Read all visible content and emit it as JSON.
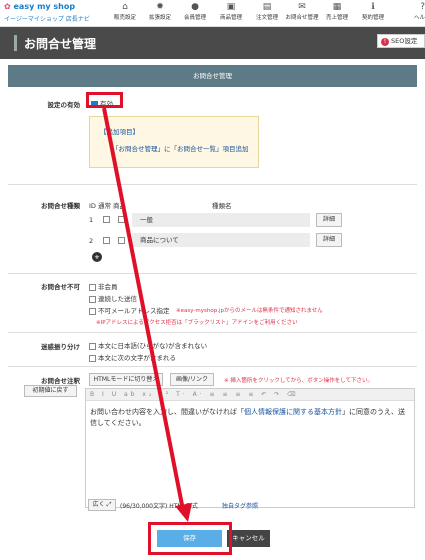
{
  "app": {
    "logo": "easy my shop",
    "logo_sub": "イージーマイショップ 店長ナビ"
  },
  "nav": [
    "販売設定",
    "拡張設定",
    "会員管理",
    "商品管理",
    "注文管理",
    "お問合せ管理",
    "売上管理",
    "契約管理",
    "ヘル"
  ],
  "nav_icons": [
    "home-icon",
    "gear-icon",
    "person-icon",
    "gift-icon",
    "cart-icon",
    "mail-icon",
    "calculator-icon",
    "info-icon",
    "help-icon"
  ],
  "page_title": "お問合せ管理",
  "seo_label": "SEO設定",
  "section_header": "お問合せ管理",
  "enabled": {
    "label": "設定の有効",
    "option": "有効",
    "checked": true
  },
  "notice": {
    "title": "【追加項目】",
    "body": "「お問合せ管理」に「お問合せ一覧」項目追加"
  },
  "types": {
    "label": "お問合せ種類",
    "cols": "ID 通常 商品",
    "col_name": "種類名",
    "rows": [
      {
        "id": "1",
        "name": "一般",
        "btn": "詳細"
      },
      {
        "id": "2",
        "name": "商品について",
        "btn": "詳細"
      }
    ]
  },
  "not_allowed": {
    "label": "お問合せ不可",
    "options": [
      "非会員",
      "連続した送信",
      "不可メールアドレス指定"
    ],
    "note1": "※easy-myshop.jpからのメールは無条件で通知されません",
    "note2": "※IPアドレスによるアクセス拒否は「ブラックリスト」アドインをご利用ください"
  },
  "spam": {
    "label": "迷惑振り分け",
    "options": [
      "本文に日本語(ひらがな)が含まれない",
      "本文に次の文字が含まれる"
    ]
  },
  "caution": {
    "label": "お問合せ注釈",
    "reset": "初期値に戻す",
    "html_mode": "HTMLモードに切り替え",
    "image_link": "画像/リンク",
    "hint": "※ 挿入箇所をクリックしてから、ボタン操作をして下さい。",
    "toolbar": "B I U ab x₂ x² T· A· ≡ ≡ ≡ ≡ ↶ ↷ ⌫",
    "text_before": "お問い合わせ内容を入力し、間違いがなければ「",
    "link_text": "個人情報保護に関する基本方針",
    "text_after": "」に同意のうえ、送信してください。",
    "expand": "広く",
    "counter": "(96/30,000文字) HTML形式",
    "tag_ref": "独自タグ参照"
  },
  "actions": {
    "save": "保存",
    "cancel": "キャンセル"
  },
  "highlight_color": "#e0102a"
}
